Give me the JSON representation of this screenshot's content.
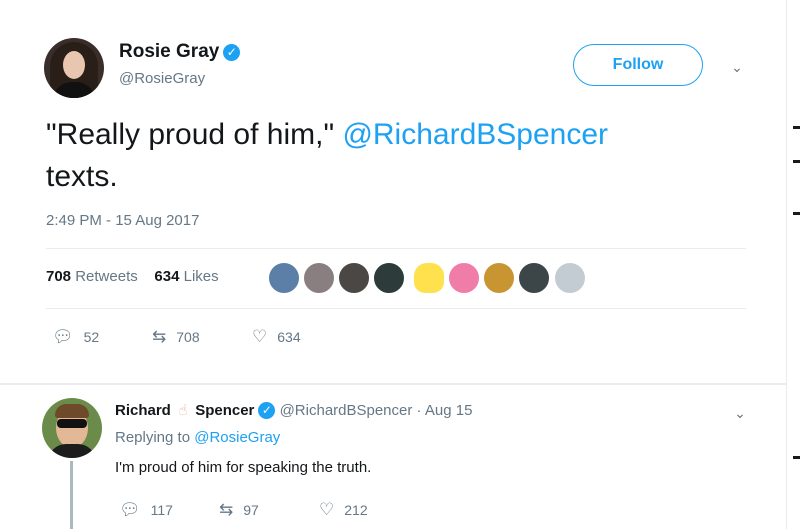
{
  "tweet": {
    "author_name": "Rosie Gray",
    "author_handle": "@RosieGray",
    "follow_label": "Follow",
    "text_part1": "\"Really proud of him,\" ",
    "text_mention": "@RichardBSpencer",
    "text_part2": "texts.",
    "timestamp": "2:49 PM - 15 Aug 2017",
    "retweets_count": "708",
    "retweets_label": "Retweets",
    "likes_count": "634",
    "likes_label": "Likes",
    "reply_action_count": "52",
    "retweet_action_count": "708",
    "like_action_count": "634"
  },
  "reply": {
    "name_first": "Richard",
    "name_last": "Spencer",
    "handle": "@RichardBSpencer",
    "separator": "·",
    "date": "Aug 15",
    "replying_prefix": "Replying to",
    "replying_to": "@RosieGray",
    "text": "I'm proud of him for speaking the truth.",
    "reply_count": "117",
    "retweet_count": "97",
    "like_count": "212"
  },
  "colors": {
    "accent": "#1da1f2",
    "muted": "#657786",
    "text": "#14171a"
  },
  "icons": {
    "verified": "verified-badge-icon",
    "chevron": "chevron-down-icon",
    "reply": "reply-icon",
    "retweet": "retweet-icon",
    "like": "heart-icon"
  }
}
